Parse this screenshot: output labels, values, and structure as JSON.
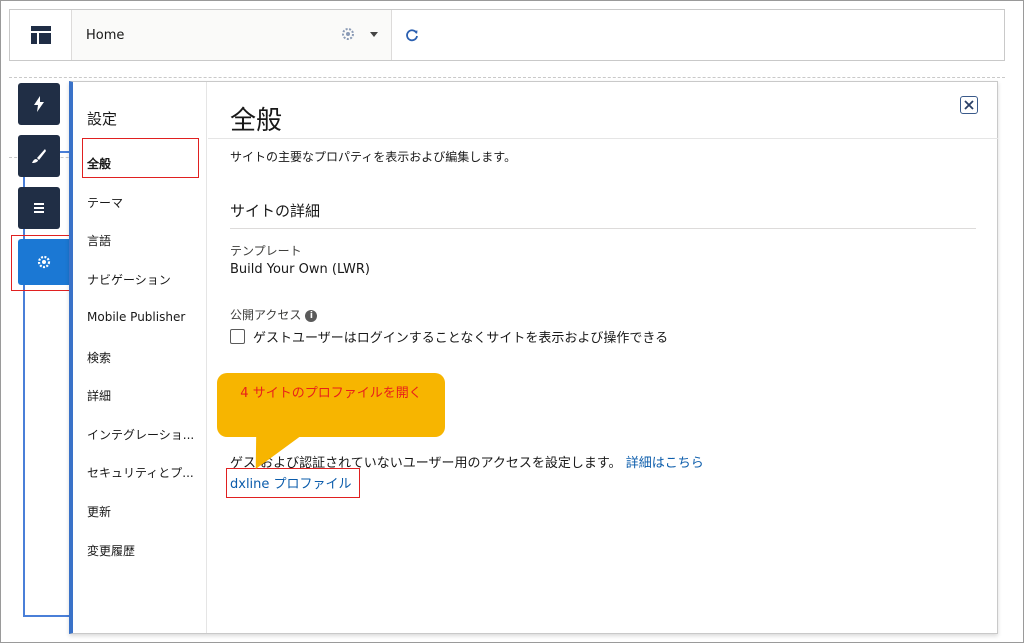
{
  "topbar": {
    "page_label": "Home",
    "app_icon": "layout-icon",
    "gear_icon": "gear-icon",
    "refresh_icon": "refresh-icon"
  },
  "rail": {
    "items": [
      {
        "icon": "lightning-icon"
      },
      {
        "icon": "brush-icon"
      },
      {
        "icon": "list-icon"
      },
      {
        "icon": "gear-icon"
      }
    ]
  },
  "settings_nav": {
    "title": "設定",
    "items": [
      "全般",
      "テーマ",
      "言語",
      "ナビゲーション",
      "Mobile Publisher",
      "検索",
      "詳細",
      "インテグレーショ...",
      "セキュリティとプ...",
      "更新",
      "変更履歴"
    ]
  },
  "general": {
    "title": "全般",
    "description": "サイトの主要なプロパティを表示および編集します。",
    "section_title": "サイトの詳細",
    "template_label": "テンプレート",
    "template_value": "Build Your Own (LWR)",
    "public_access_label": "公開アクセス",
    "public_access_checkbox": "ゲストユーザーはログインすることなくサイトを表示および操作できる",
    "guest_description": "ゲス  および認証されていないユーザー用のアクセスを設定します。",
    "learn_more": "詳細はこちら",
    "profile_link": "dxline プロファイル"
  },
  "callout": {
    "text": "4 サイトのプロファイルを開く"
  },
  "colors": {
    "rail_dark": "#202e45",
    "rail_active": "#1b78d4",
    "link": "#0b5cab",
    "callout_bg": "#f7b500",
    "callout_text": "#e8201a",
    "highlight": "#e02020"
  }
}
